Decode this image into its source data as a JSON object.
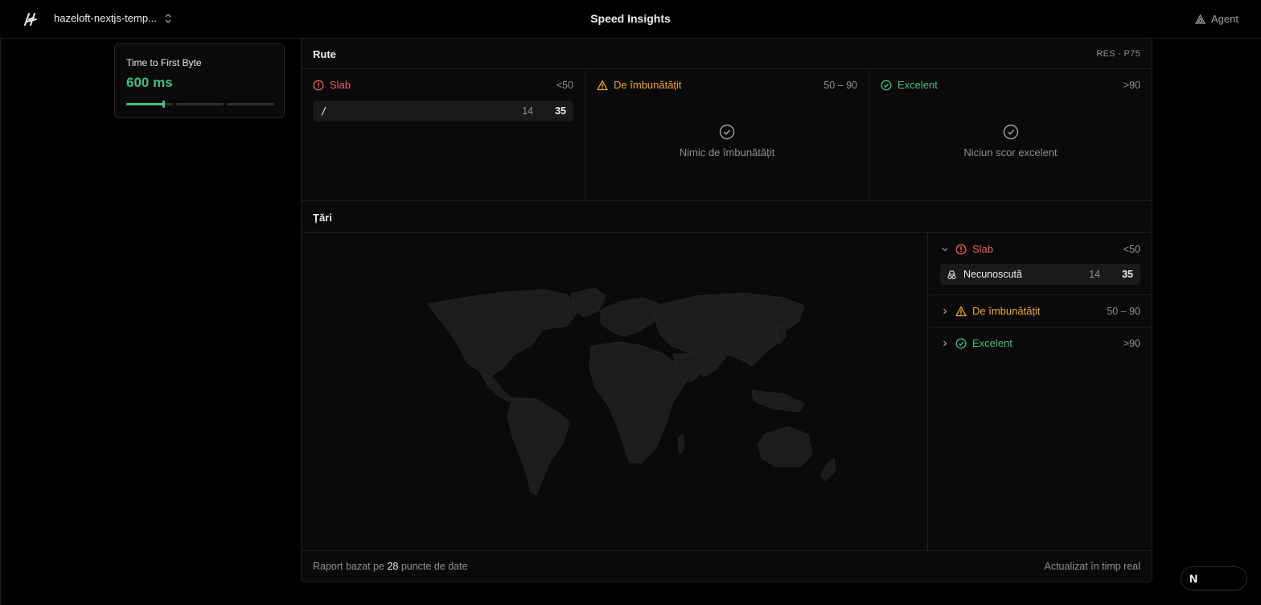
{
  "header": {
    "project_name": "hazeloft-nextjs-temp...",
    "page_title": "Speed Insights",
    "agent_label": "Agent"
  },
  "metric_card": {
    "label": "Time to First Byte",
    "value": "600 ms",
    "indicator_fraction": 0.25
  },
  "routes": {
    "title": "Rute",
    "meta": "RES · P75",
    "columns": [
      {
        "label": "Slab",
        "range": "<50",
        "status": "poor"
      },
      {
        "label": "De îmbunătățit",
        "range": "50 – 90",
        "status": "needs-improvement",
        "empty_text": "Nimic de îmbunătățit"
      },
      {
        "label": "Excelent",
        "range": ">90",
        "status": "good",
        "empty_text": "Niciun scor excelent"
      }
    ],
    "poor_rows": [
      {
        "path": "/",
        "count": "14",
        "score": "35"
      }
    ]
  },
  "countries": {
    "title": "Țări",
    "groups": [
      {
        "label": "Slab",
        "range": "<50",
        "expanded": true
      },
      {
        "label": "De îmbunătățit",
        "range": "50 – 90",
        "expanded": false
      },
      {
        "label": "Excelent",
        "range": ">90",
        "expanded": false
      }
    ],
    "poor_rows": [
      {
        "name": "Necunoscută",
        "icon": "incognito-icon",
        "count": "14",
        "score": "35"
      }
    ]
  },
  "footer": {
    "prefix": "Raport bazat pe",
    "count": "28",
    "suffix": "puncte de date",
    "right": "Actualizat în timp real"
  },
  "colors": {
    "poor": "#f0605a",
    "needs_improvement": "#f2a530",
    "good": "#45bf80"
  },
  "badge": {
    "label": "N"
  }
}
